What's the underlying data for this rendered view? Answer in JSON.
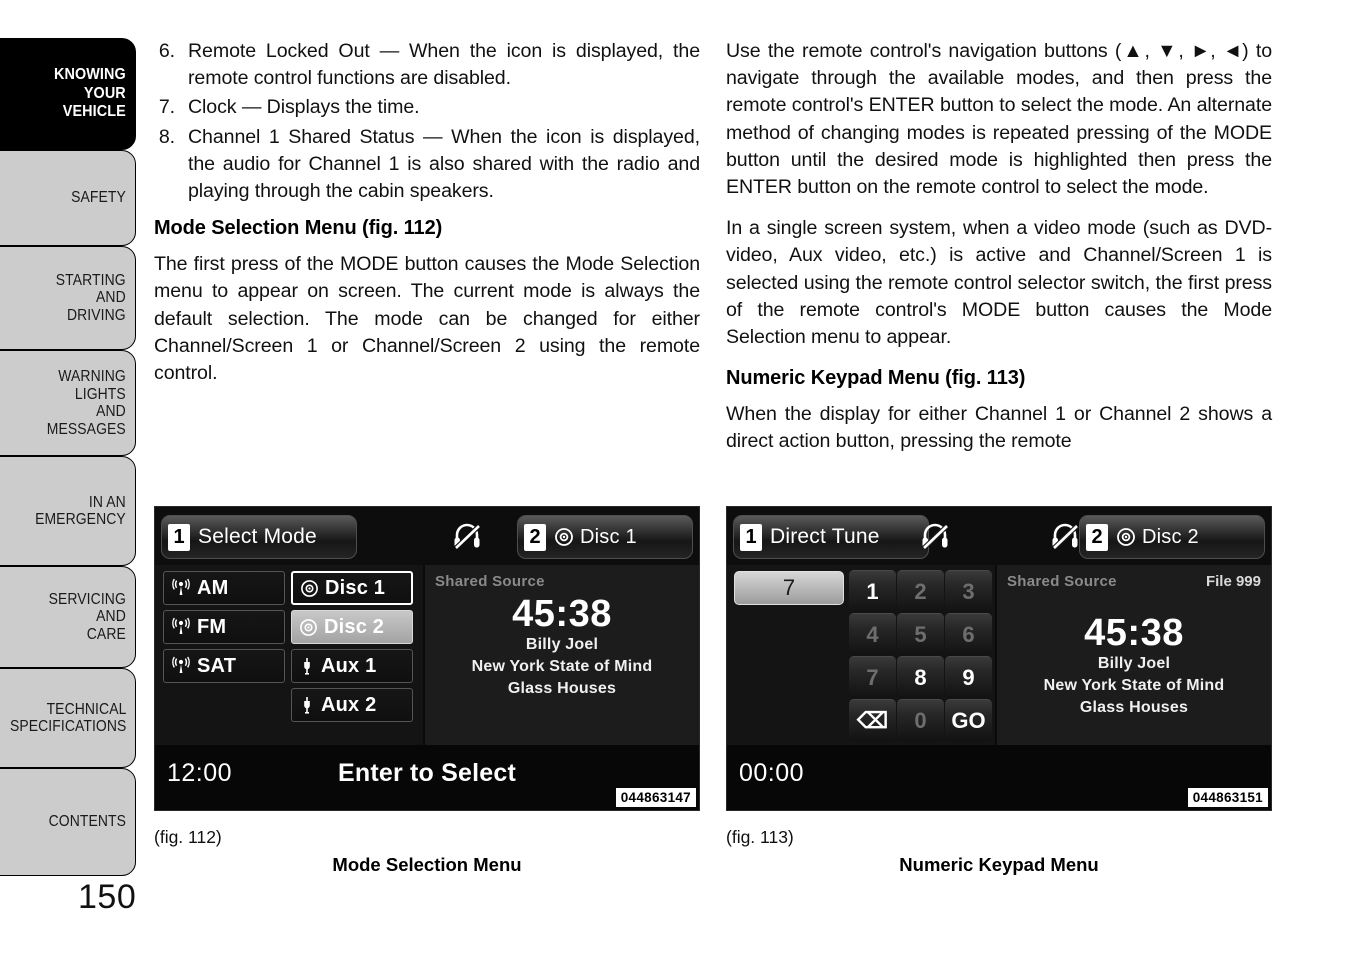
{
  "page": {
    "number": "150"
  },
  "sidebar": {
    "items": [
      {
        "label": "KNOWING\nYOUR\nVEHICLE",
        "active": true
      },
      {
        "label": "SAFETY",
        "active": false
      },
      {
        "label": "STARTING\nAND\nDRIVING",
        "active": false
      },
      {
        "label": "WARNING\nLIGHTS\nAND\nMESSAGES",
        "active": false
      },
      {
        "label": "IN AN\nEMERGENCY",
        "active": false
      },
      {
        "label": "SERVICING\nAND\nCARE",
        "active": false
      },
      {
        "label": "TECHNICAL\nSPECIFICATIONS",
        "active": false
      },
      {
        "label": "CONTENTS",
        "active": false
      }
    ]
  },
  "left_column": {
    "list": [
      {
        "num": "6.",
        "text": "Remote Locked Out — When the icon is displayed, the remote control functions are disabled."
      },
      {
        "num": "7.",
        "text": "Clock — Displays the time."
      },
      {
        "num": "8.",
        "text": "Channel 1 Shared Status — When the icon is displayed, the audio for Channel 1 is also shared with the radio and playing through the cabin speakers."
      }
    ],
    "heading": "Mode Selection Menu (fig. 112)",
    "paragraph": "The first press of the MODE button causes the Mode Selection menu to appear on screen. The current mode is always the default selection. The mode can be changed for either Channel/Screen 1 or Channel/Screen 2 using the remote control."
  },
  "right_column": {
    "paragraph1": "Use the remote control's navigation buttons (▲, ▼, ►, ◄) to navigate through the available modes, and then press the remote control's ENTER button to select the mode. An alternate method of changing modes is repeated pressing of the MODE button until the desired mode is highlighted then press the ENTER button on the remote control to select the mode.",
    "paragraph2": "In a single screen system, when a video mode (such as DVD-video, Aux video, etc.) is active and Channel/Screen 1 is selected using the remote control selector switch, the first press of the remote control's MODE button causes the Mode Selection menu to appear.",
    "heading": "Numeric Keypad Menu (fig. 113)",
    "paragraph3": "When the display for either Channel 1 or Channel 2 shows a direct action button, pressing the remote"
  },
  "figure_112": {
    "fig_label": "(fig. 112)",
    "caption": "Mode Selection Menu",
    "part_number": "044863147",
    "header": {
      "left_channel": "1",
      "left_title": "Select Mode",
      "right_channel": "2",
      "right_title": "Disc 1",
      "headphone_icon": "headphones-muted-icon"
    },
    "mode_buttons": [
      {
        "label": "AM",
        "icon": "broadcast-icon",
        "state": "normal"
      },
      {
        "label": "FM",
        "icon": "broadcast-icon",
        "state": "normal"
      },
      {
        "label": "SAT",
        "icon": "broadcast-icon",
        "state": "normal"
      }
    ],
    "source_buttons": [
      {
        "label": "Disc 1",
        "icon": "disc-icon",
        "state": "focused"
      },
      {
        "label": "Disc 2",
        "icon": "disc-icon",
        "state": "selected"
      },
      {
        "label": "Aux 1",
        "icon": "aux-plug-icon",
        "state": "normal"
      },
      {
        "label": "Aux 2",
        "icon": "aux-plug-icon",
        "state": "normal"
      }
    ],
    "info": {
      "shared_source": "Shared Source",
      "time": "45:38",
      "artist": "Billy Joel",
      "track": "New York State of Mind",
      "album": "Glass Houses"
    },
    "footer": {
      "clock": "12:00",
      "hint": "Enter to Select"
    }
  },
  "figure_113": {
    "fig_label": "(fig. 113)",
    "caption": "Numeric Keypad Menu",
    "part_number": "044863151",
    "header": {
      "left_channel": "1",
      "left_title": "Direct Tune",
      "right_channel": "2",
      "right_title": "Disc 2",
      "headphone_icon": "headphones-muted-icon"
    },
    "entry_display": "7",
    "keys": [
      [
        {
          "label": "1",
          "bright": true
        },
        {
          "label": "2",
          "bright": false
        },
        {
          "label": "3",
          "bright": false
        }
      ],
      [
        {
          "label": "4",
          "bright": false
        },
        {
          "label": "5",
          "bright": false
        },
        {
          "label": "6",
          "bright": false
        }
      ],
      [
        {
          "label": "7",
          "bright": false
        },
        {
          "label": "8",
          "bright": true
        },
        {
          "label": "9",
          "bright": true
        }
      ],
      [
        {
          "label": "⌫",
          "bright": true
        },
        {
          "label": "0",
          "bright": false
        },
        {
          "label": "GO",
          "bright": true
        }
      ]
    ],
    "info": {
      "shared_source": "Shared Source",
      "file_number": "File 999",
      "time": "45:38",
      "artist": "Billy Joel",
      "track": "New York State of Mind",
      "album": "Glass Houses"
    },
    "footer": {
      "clock": "00:00"
    }
  }
}
